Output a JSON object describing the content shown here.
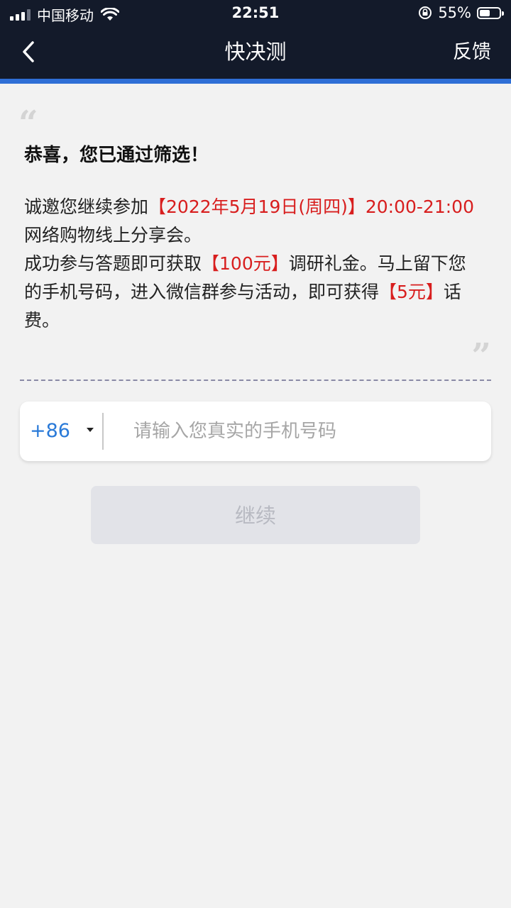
{
  "status_bar": {
    "carrier": "中国移动",
    "time": "22:51",
    "battery_percent": "55%",
    "battery_level": 0.55,
    "icons": [
      "signal-icon",
      "wifi-icon",
      "rotation-lock-icon",
      "battery-icon"
    ]
  },
  "nav": {
    "back_icon": "chevron-left-icon",
    "title": "快决测",
    "feedback": "反馈"
  },
  "colors": {
    "nav_bg": "#131a2a",
    "accent": "#2f6fd6",
    "highlight_red": "#d81e1e",
    "link_blue": "#2a7ad8"
  },
  "message": {
    "open_quote": "“",
    "close_quote": "”",
    "headline": "恭喜，您已通过筛选！",
    "p1_a": "诚邀您继续参加",
    "p1_red": "【2022年5月19日(周四)】20:00-21:00",
    "p1_b": " 网络购物线上分享会。",
    "p2_a": "成功参与答题即可获取",
    "p2_red": "【100元】",
    "p2_b": "调研礼金。马上留下您的手机号码，进入微信群参与活动，即可获得",
    "p2_red2": "【5元】",
    "p2_c": "话费。"
  },
  "form": {
    "country_code": "+86",
    "phone_placeholder": "请输入您真实的手机号码",
    "phone_value": "",
    "continue_label": "继续"
  }
}
